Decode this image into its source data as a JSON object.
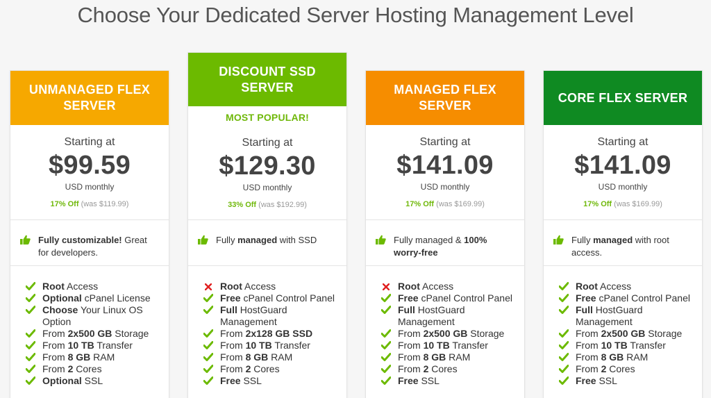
{
  "page": {
    "title": "Choose Your Dedicated Server Hosting Management Level"
  },
  "colors": {
    "orange_yellow": "#f6a800",
    "green": "#6cba00",
    "orange": "#f68d00",
    "dark_green": "#0f8a22",
    "check": "#6cba00",
    "cross": "#e02020"
  },
  "plans": [
    {
      "name": "UNMANAGED FLEX SERVER",
      "color": "#f6a800",
      "badge": "",
      "starting": "Starting at",
      "price": "$99.59",
      "period": "USD monthly",
      "discount_off": "17% Off",
      "discount_was": "(was $119.99)",
      "highlight": [
        {
          "t": "Fully customizable!",
          "b": true
        },
        {
          "t": " Great for developers.",
          "b": false
        }
      ],
      "features": [
        {
          "icon": "check",
          "parts": [
            {
              "t": "Root",
              "b": true
            },
            {
              "t": " Access",
              "b": false
            }
          ]
        },
        {
          "icon": "check",
          "parts": [
            {
              "t": "Optional",
              "b": true
            },
            {
              "t": " cPanel License",
              "b": false
            }
          ]
        },
        {
          "icon": "check",
          "parts": [
            {
              "t": "Choose",
              "b": true
            },
            {
              "t": " Your Linux OS Option",
              "b": false
            }
          ]
        },
        {
          "icon": "check",
          "parts": [
            {
              "t": "From ",
              "b": false
            },
            {
              "t": "2x500 GB",
              "b": true
            },
            {
              "t": " Storage",
              "b": false
            }
          ]
        },
        {
          "icon": "check",
          "parts": [
            {
              "t": "From ",
              "b": false
            },
            {
              "t": "10 TB",
              "b": true
            },
            {
              "t": " Transfer",
              "b": false
            }
          ]
        },
        {
          "icon": "check",
          "parts": [
            {
              "t": "From ",
              "b": false
            },
            {
              "t": "8 GB",
              "b": true
            },
            {
              "t": " RAM",
              "b": false
            }
          ]
        },
        {
          "icon": "check",
          "parts": [
            {
              "t": "From ",
              "b": false
            },
            {
              "t": "2",
              "b": true
            },
            {
              "t": " Cores",
              "b": false
            }
          ]
        },
        {
          "icon": "check",
          "parts": [
            {
              "t": "Optional",
              "b": true
            },
            {
              "t": " SSL",
              "b": false
            }
          ]
        }
      ]
    },
    {
      "name": "DISCOUNT SSD SERVER",
      "color": "#6cba00",
      "badge": "MOST POPULAR!",
      "starting": "Starting at",
      "price": "$129.30",
      "period": "USD monthly",
      "discount_off": "33% Off",
      "discount_was": "(was $192.99)",
      "highlight": [
        {
          "t": "Fully ",
          "b": false
        },
        {
          "t": "managed",
          "b": true
        },
        {
          "t": " with SSD",
          "b": false
        }
      ],
      "features": [
        {
          "icon": "cross",
          "parts": [
            {
              "t": "Root",
              "b": true
            },
            {
              "t": " Access",
              "b": false
            }
          ]
        },
        {
          "icon": "check",
          "parts": [
            {
              "t": "Free",
              "b": true
            },
            {
              "t": " cPanel Control Panel",
              "b": false
            }
          ]
        },
        {
          "icon": "check",
          "parts": [
            {
              "t": "Full",
              "b": true
            },
            {
              "t": " HostGuard Management",
              "b": false
            }
          ]
        },
        {
          "icon": "check",
          "parts": [
            {
              "t": "From ",
              "b": false
            },
            {
              "t": "2x128 GB SSD",
              "b": true
            }
          ]
        },
        {
          "icon": "check",
          "parts": [
            {
              "t": "From ",
              "b": false
            },
            {
              "t": "10 TB",
              "b": true
            },
            {
              "t": " Transfer",
              "b": false
            }
          ]
        },
        {
          "icon": "check",
          "parts": [
            {
              "t": "From ",
              "b": false
            },
            {
              "t": "8 GB",
              "b": true
            },
            {
              "t": " RAM",
              "b": false
            }
          ]
        },
        {
          "icon": "check",
          "parts": [
            {
              "t": "From ",
              "b": false
            },
            {
              "t": "2",
              "b": true
            },
            {
              "t": " Cores",
              "b": false
            }
          ]
        },
        {
          "icon": "check",
          "parts": [
            {
              "t": "Free",
              "b": true
            },
            {
              "t": " SSL",
              "b": false
            }
          ]
        }
      ]
    },
    {
      "name": "MANAGED FLEX SERVER",
      "color": "#f68d00",
      "badge": "",
      "starting": "Starting at",
      "price": "$141.09",
      "period": "USD monthly",
      "discount_off": "17% Off",
      "discount_was": "(was $169.99)",
      "highlight": [
        {
          "t": "Fully managed & ",
          "b": false
        },
        {
          "t": "100% worry-free",
          "b": true
        }
      ],
      "features": [
        {
          "icon": "cross",
          "parts": [
            {
              "t": "Root",
              "b": true
            },
            {
              "t": " Access",
              "b": false
            }
          ]
        },
        {
          "icon": "check",
          "parts": [
            {
              "t": "Free",
              "b": true
            },
            {
              "t": " cPanel Control Panel",
              "b": false
            }
          ]
        },
        {
          "icon": "check",
          "parts": [
            {
              "t": "Full",
              "b": true
            },
            {
              "t": " HostGuard Management",
              "b": false
            }
          ]
        },
        {
          "icon": "check",
          "parts": [
            {
              "t": "From ",
              "b": false
            },
            {
              "t": "2x500 GB",
              "b": true
            },
            {
              "t": " Storage",
              "b": false
            }
          ]
        },
        {
          "icon": "check",
          "parts": [
            {
              "t": "From ",
              "b": false
            },
            {
              "t": "10 TB",
              "b": true
            },
            {
              "t": " Transfer",
              "b": false
            }
          ]
        },
        {
          "icon": "check",
          "parts": [
            {
              "t": "From ",
              "b": false
            },
            {
              "t": "8 GB",
              "b": true
            },
            {
              "t": " RAM",
              "b": false
            }
          ]
        },
        {
          "icon": "check",
          "parts": [
            {
              "t": "From ",
              "b": false
            },
            {
              "t": "2",
              "b": true
            },
            {
              "t": " Cores",
              "b": false
            }
          ]
        },
        {
          "icon": "check",
          "parts": [
            {
              "t": "Free",
              "b": true
            },
            {
              "t": " SSL",
              "b": false
            }
          ]
        }
      ]
    },
    {
      "name": "CORE FLEX SERVER",
      "color": "#0f8a22",
      "badge": "",
      "starting": "Starting at",
      "price": "$141.09",
      "period": "USD monthly",
      "discount_off": "17% Off",
      "discount_was": "(was $169.99)",
      "highlight": [
        {
          "t": "Fully ",
          "b": false
        },
        {
          "t": "managed",
          "b": true
        },
        {
          "t": " with root access.",
          "b": false
        }
      ],
      "features": [
        {
          "icon": "check",
          "parts": [
            {
              "t": "Root",
              "b": true
            },
            {
              "t": " Access",
              "b": false
            }
          ]
        },
        {
          "icon": "check",
          "parts": [
            {
              "t": "Free",
              "b": true
            },
            {
              "t": " cPanel Control Panel",
              "b": false
            }
          ]
        },
        {
          "icon": "check",
          "parts": [
            {
              "t": "Full",
              "b": true
            },
            {
              "t": " HostGuard Management",
              "b": false
            }
          ]
        },
        {
          "icon": "check",
          "parts": [
            {
              "t": "From ",
              "b": false
            },
            {
              "t": "2x500 GB",
              "b": true
            },
            {
              "t": " Storage",
              "b": false
            }
          ]
        },
        {
          "icon": "check",
          "parts": [
            {
              "t": "From ",
              "b": false
            },
            {
              "t": "10 TB",
              "b": true
            },
            {
              "t": " Transfer",
              "b": false
            }
          ]
        },
        {
          "icon": "check",
          "parts": [
            {
              "t": "From ",
              "b": false
            },
            {
              "t": "8 GB",
              "b": true
            },
            {
              "t": " RAM",
              "b": false
            }
          ]
        },
        {
          "icon": "check",
          "parts": [
            {
              "t": "From ",
              "b": false
            },
            {
              "t": "2",
              "b": true
            },
            {
              "t": " Cores",
              "b": false
            }
          ]
        },
        {
          "icon": "check",
          "parts": [
            {
              "t": "Free",
              "b": true
            },
            {
              "t": " SSL",
              "b": false
            }
          ]
        }
      ]
    }
  ]
}
